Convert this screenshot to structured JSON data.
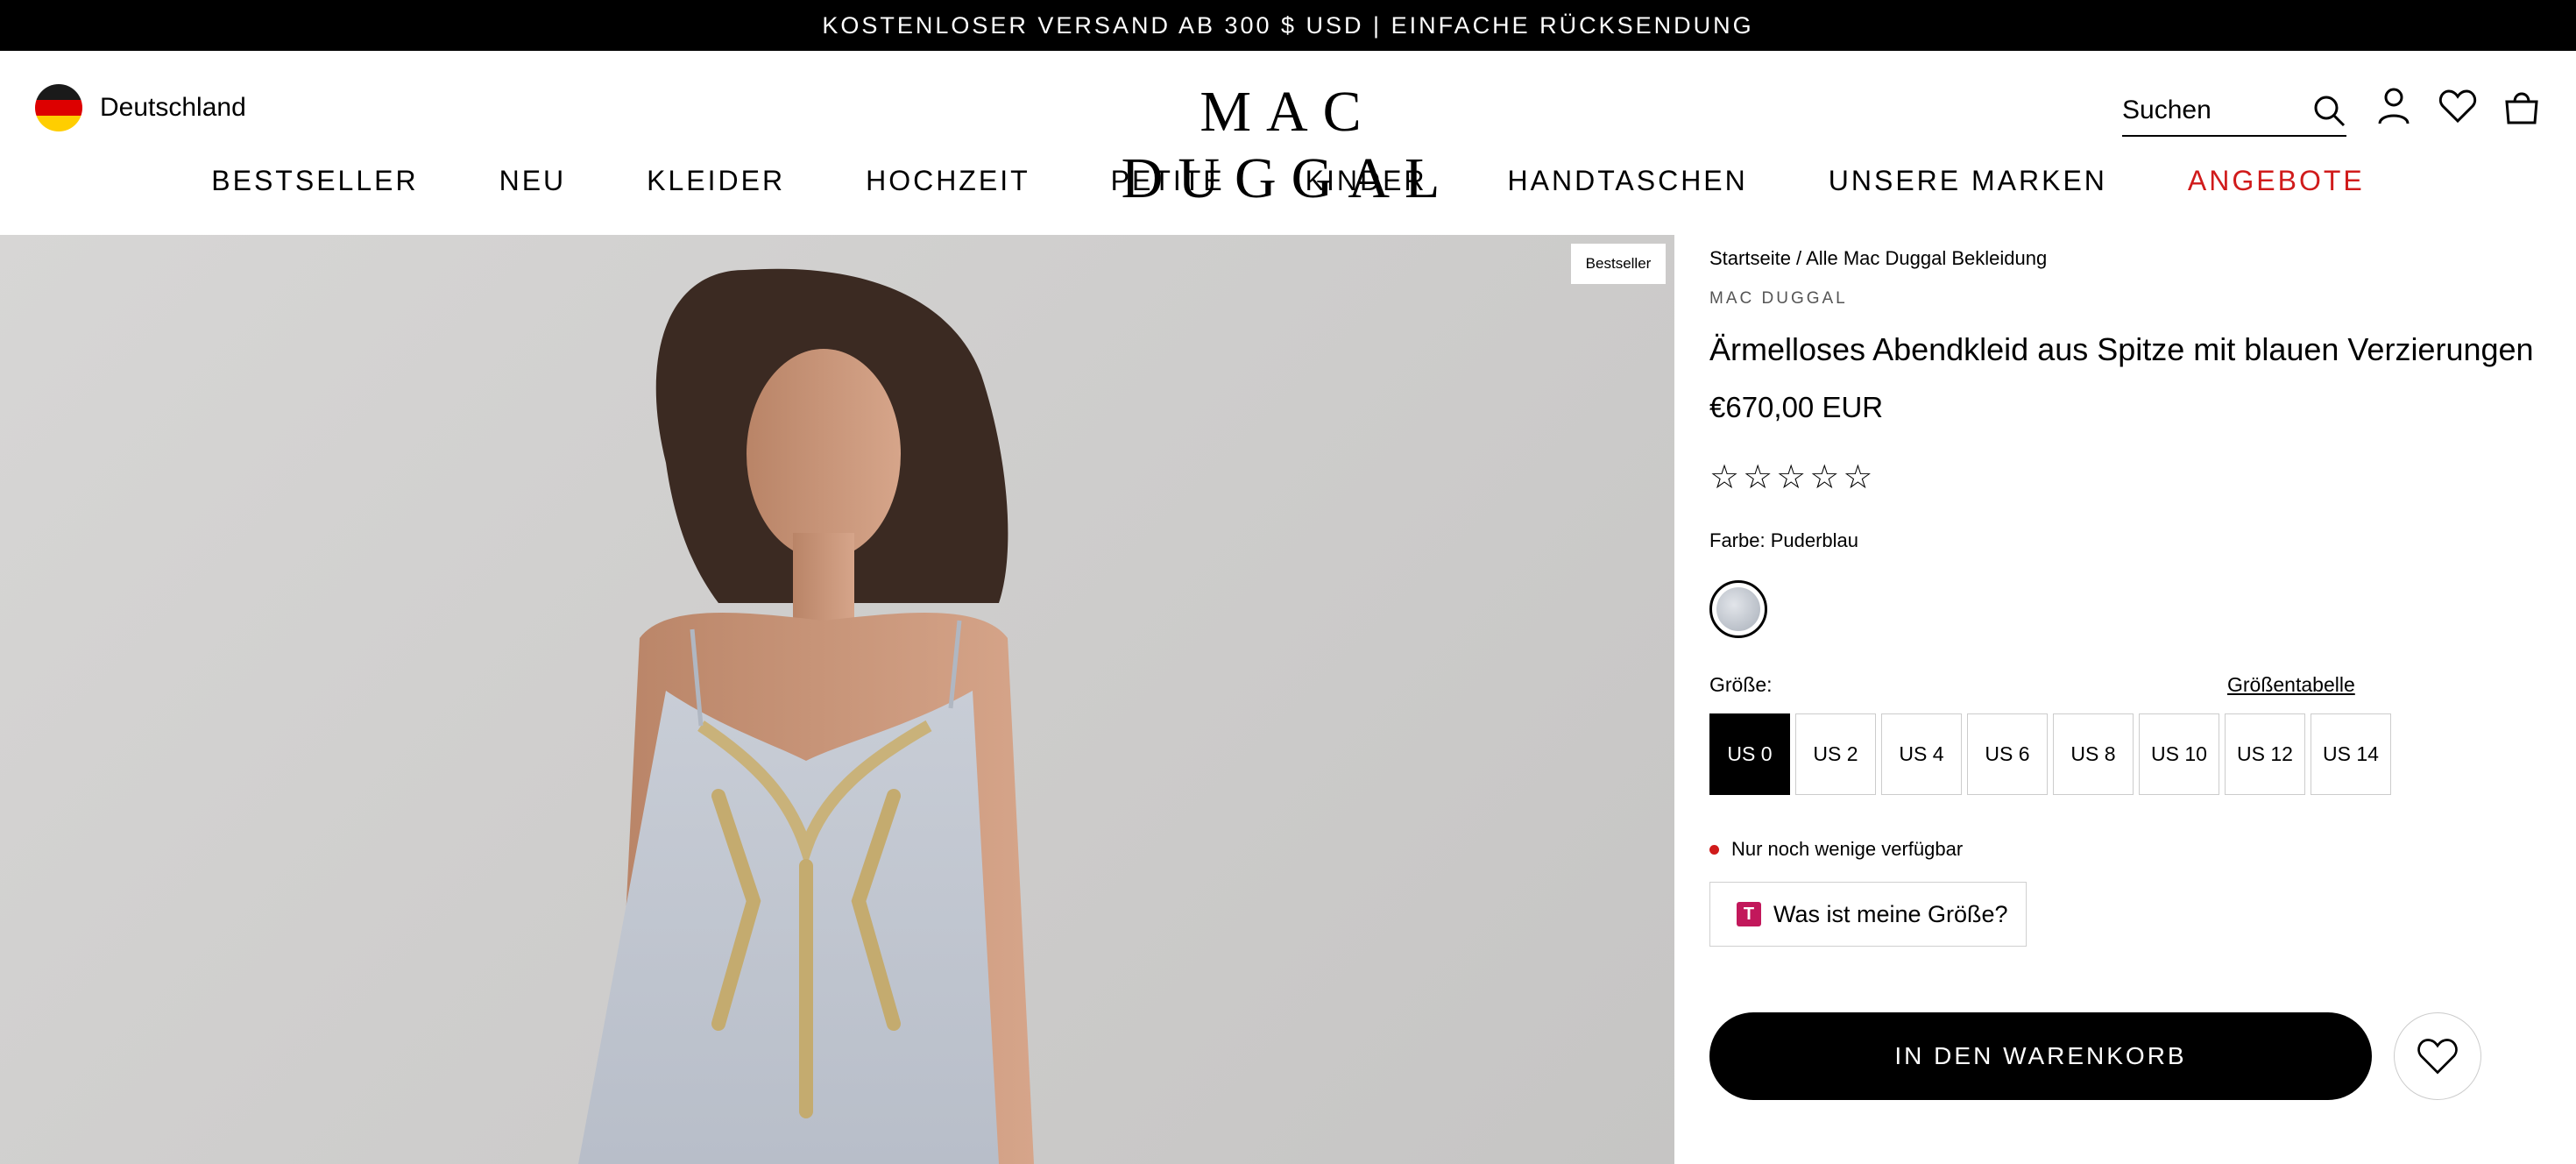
{
  "announcement": "KOSTENLOSER VERSAND AB 300 $ USD | EINFACHE RÜCKSENDUNG",
  "header": {
    "country": "Deutschland",
    "logo": "MAC DUGGAL",
    "search_placeholder": "Suchen",
    "icons": [
      "search-icon",
      "account-icon",
      "heart-icon",
      "bag-icon"
    ]
  },
  "nav": {
    "items": [
      {
        "label": "BESTSELLER"
      },
      {
        "label": "NEU"
      },
      {
        "label": "KLEIDER"
      },
      {
        "label": "HOCHZEIT"
      },
      {
        "label": "PETITE"
      },
      {
        "label": "KINDER"
      },
      {
        "label": "HANDTASCHEN"
      },
      {
        "label": "UNSERE MARKEN"
      },
      {
        "label": "ANGEBOTE",
        "color": "#d01b1b"
      }
    ]
  },
  "gallery": {
    "badge": "Bestseller"
  },
  "product": {
    "breadcrumb_home": "Startseite",
    "breadcrumb_sep": " / ",
    "breadcrumb_current": "Alle Mac Duggal Bekleidung",
    "brand": "MAC DUGGAL",
    "title": "Ärmelloses Abendkleid aus Spitze mit blauen Verzierungen",
    "price": "€670,00 EUR",
    "rating_stars": 0,
    "rating_max": 5,
    "color_label": "Farbe: Puderblau",
    "size_label": "Größe:",
    "size_chart": "Größentabelle",
    "sizes": [
      "US 0",
      "US 2",
      "US 4",
      "US 6",
      "US 8",
      "US 10",
      "US 12",
      "US 14"
    ],
    "selected_size": "US 0",
    "stock_text": "Nur noch wenige verfügbar",
    "fit_finder": "Was ist meine Größe?",
    "add_to_cart": "IN DEN WARENKORB"
  },
  "colors": {
    "announce_bg": "#000000",
    "sale": "#d01b1b",
    "stock_dot": "#d01b1b",
    "fit_logo": "#c2185b"
  }
}
